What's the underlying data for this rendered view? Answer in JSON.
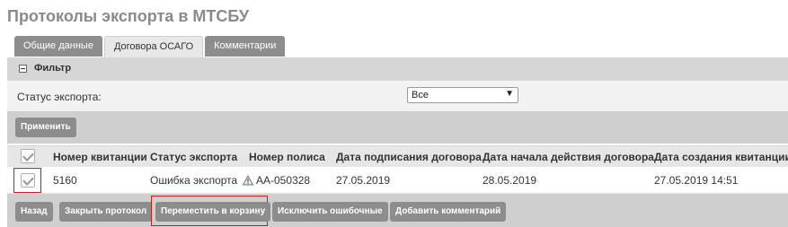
{
  "page": {
    "title": "Протоколы экспорта в МТСБУ"
  },
  "tabs": [
    {
      "label": "Общие данные",
      "active": false
    },
    {
      "label": "Договора ОСАГО",
      "active": true
    },
    {
      "label": "Комментарии",
      "active": false
    }
  ],
  "filter": {
    "title": "Фильтр",
    "status_label": "Статус экспорта:",
    "status_value": "Все",
    "apply_label": "Применить"
  },
  "table": {
    "columns": [
      "Номер квитанции",
      "Статус экспорта",
      "Номер полиса",
      "Дата подписания договора",
      "Дата начала действия договора",
      "Дата создания квитанции"
    ],
    "rows": [
      {
        "checked": true,
        "receipt_number": "5160",
        "export_status": "Ошибка экспорта",
        "policy_number": "АА-050328",
        "sign_date": "27.05.2019",
        "start_date": "28.05.2019",
        "created": "27.05.2019 14:51"
      }
    ]
  },
  "actions": {
    "back": "Назад",
    "close_protocol": "Закрыть протокол",
    "move_to_trash": "Переместить в корзину",
    "exclude_errors": "Исключить ошибочные",
    "add_comment": "Добавить комментарий"
  },
  "colors": {
    "button_bg": "#8d8d8d",
    "highlight": "#d11a1a",
    "title": "#8a8a8a"
  },
  "icons": {
    "collapse": "minus-square-icon",
    "select_arrow": "caret-down-icon",
    "status_warning": "warning-triangle-icon",
    "checkbox": "checkmark-icon"
  }
}
